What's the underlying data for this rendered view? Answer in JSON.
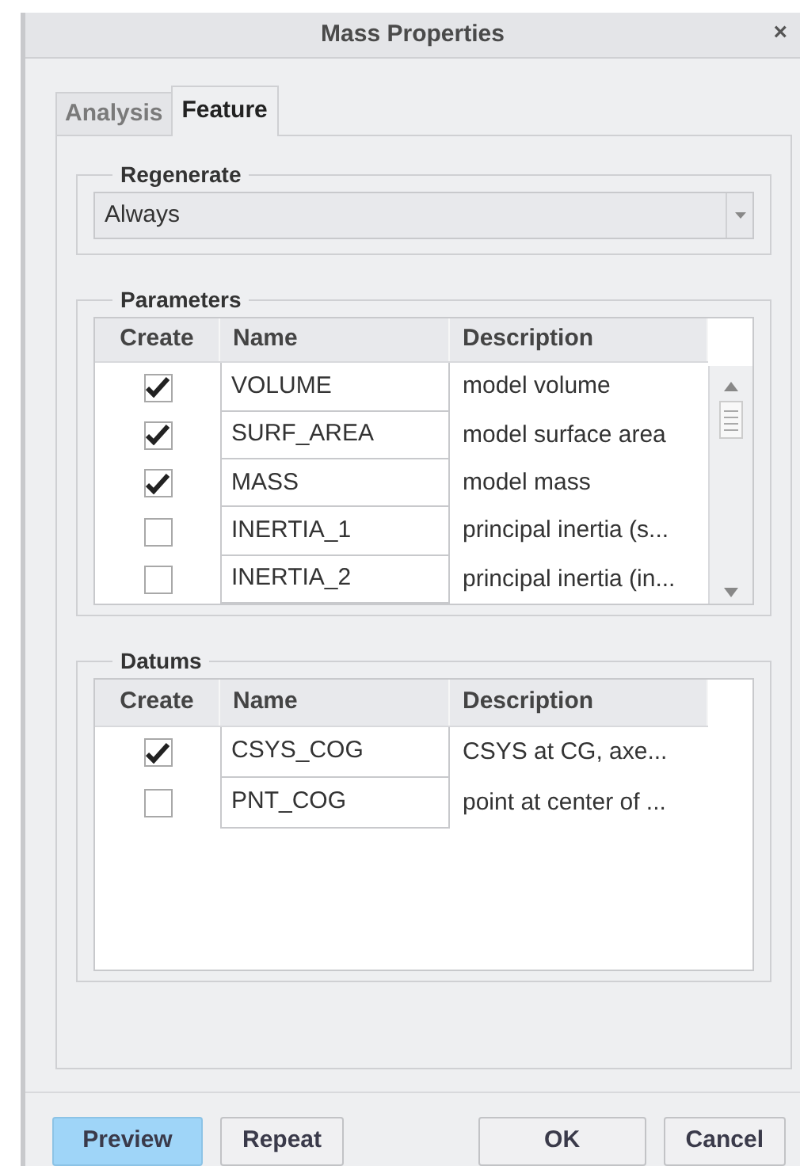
{
  "window": {
    "title": "Mass Properties",
    "close": "×"
  },
  "tabs": [
    {
      "label": "Analysis",
      "selected": false
    },
    {
      "label": "Feature",
      "selected": true
    }
  ],
  "regenerate": {
    "legend": "Regenerate",
    "value": "Always"
  },
  "parameters": {
    "legend": "Parameters",
    "columns": [
      "Create",
      "Name",
      "Description"
    ],
    "scrollbar": true,
    "rows": [
      {
        "checked": true,
        "name": "VOLUME",
        "description": "model volume"
      },
      {
        "checked": true,
        "name": "SURF_AREA",
        "description": "model surface area"
      },
      {
        "checked": true,
        "name": "MASS",
        "description": "model mass"
      },
      {
        "checked": false,
        "name": "INERTIA_1",
        "description": "principal inertia (s..."
      },
      {
        "checked": false,
        "name": "INERTIA_2",
        "description": "principal inertia (in..."
      }
    ]
  },
  "datums": {
    "legend": "Datums",
    "columns": [
      "Create",
      "Name",
      "Description"
    ],
    "rows": [
      {
        "checked": true,
        "name": "CSYS_COG",
        "description": "CSYS at CG, axe..."
      },
      {
        "checked": false,
        "name": "PNT_COG",
        "description": "point at center of ..."
      }
    ]
  },
  "left_buttons": [
    {
      "label": "Preview",
      "kind": "primary"
    },
    {
      "label": "Repeat",
      "kind": "default"
    }
  ],
  "right_buttons": [
    {
      "label": "OK",
      "kind": "default"
    },
    {
      "label": "Cancel",
      "kind": "default"
    }
  ]
}
